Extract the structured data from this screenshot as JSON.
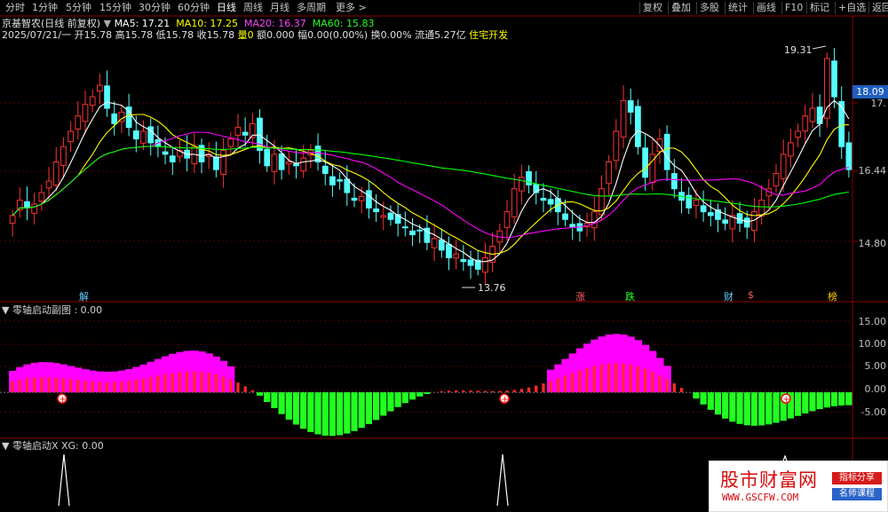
{
  "toolbar": {
    "periods": [
      "分时",
      "1分钟",
      "5分钟",
      "15分钟",
      "30分钟",
      "60分钟",
      "日线",
      "周线",
      "月线",
      "多周期",
      "更多"
    ],
    "active_period": "日线",
    "right_buttons": [
      "复权",
      "叠加",
      "多股",
      "统计",
      "画线",
      "F10",
      "标记",
      "+自选",
      "返回"
    ]
  },
  "stock": {
    "name": "京基智农(日线 前复权)",
    "ma_legend": {
      "ma5": {
        "label": "MA5:",
        "value": "17.21",
        "color": "#ffffff"
      },
      "ma10": {
        "label": "MA10:",
        "value": "17.25",
        "color": "#ffff00"
      },
      "ma20": {
        "label": "MA20:",
        "value": "16.37",
        "color": "#ff00ff"
      },
      "ma60": {
        "label": "MA60:",
        "value": "15.83",
        "color": "#00ff00"
      }
    },
    "date": "2025/07/21/一",
    "open_label": "开",
    "open": "15.78",
    "high_label": "高",
    "high": "15.78",
    "low_label": "低",
    "low": "15.78",
    "close_label": "收",
    "close": "15.78",
    "vol_label": "量",
    "vol": "0",
    "amount_label": "额",
    "amount": "0.000",
    "change_label": "幅",
    "change": "0.00(0.00%)",
    "turnover_label": "换",
    "turnover": "0.00%",
    "float_label": "流通",
    "float": "5.27亿",
    "sector": "住宅开发"
  },
  "price_axis": {
    "labels": [
      "18.09",
      "17.",
      "16.44",
      "14.80"
    ],
    "current_price": "18.09",
    "high_mark": "19.31",
    "low_mark": "13.76"
  },
  "events": [
    {
      "text": "解",
      "color": "#66ccff"
    },
    {
      "text": "涨",
      "color": "#ff6060"
    },
    {
      "text": "跌",
      "color": "#22ff22"
    },
    {
      "text": "财",
      "color": "#66ccff"
    },
    {
      "text": "$",
      "color": "#ff6060"
    },
    {
      "text": "榜",
      "color": "#ffcc00"
    }
  ],
  "sub1": {
    "label": "零轴启动副图 : 0.00",
    "axis": [
      "15.00",
      "10.00",
      "5.00",
      "0.00",
      "-5.00"
    ]
  },
  "sub2": {
    "label": "零轴启动X XG: 0.00"
  },
  "watermark": {
    "title": "股市财富网",
    "url": "WWW.GSCFW.COM",
    "badge1": "指标分享",
    "badge2": "名师课程",
    "badge1_color": "#d81b1b",
    "badge2_color": "#2a63c9"
  },
  "chart_data": {
    "type": "candlestick",
    "closes": [
      15.2,
      15.6,
      15.4,
      15.5,
      15.8,
      16.1,
      16.6,
      17.0,
      17.4,
      17.8,
      18.1,
      18.3,
      18.6,
      18.0,
      17.6,
      17.9,
      17.5,
      17.2,
      17.4,
      17.1,
      17.0,
      16.8,
      16.6,
      16.9,
      16.7,
      17.0,
      16.6,
      16.8,
      16.4,
      16.9,
      17.2,
      17.5,
      17.3,
      17.6,
      16.9,
      16.5,
      16.8,
      16.4,
      16.6,
      16.5,
      16.7,
      16.9,
      16.6,
      16.3,
      16.0,
      16.1,
      15.8,
      15.6,
      15.7,
      15.4,
      15.3,
      15.2,
      15.1,
      15.0,
      14.9,
      14.7,
      14.8,
      14.5,
      14.6,
      14.3,
      14.1,
      14.2,
      14.0,
      13.9,
      13.8,
      14.1,
      14.4,
      14.8,
      15.3,
      15.9,
      16.2,
      16.0,
      15.8,
      15.6,
      15.5,
      15.3,
      15.1,
      14.9,
      14.8,
      15.0,
      15.3,
      15.9,
      16.6,
      17.4,
      18.2,
      17.9,
      17.0,
      16.2,
      16.8,
      17.2,
      16.4,
      15.9,
      15.6,
      15.4,
      15.6,
      15.3,
      15.2,
      15.1,
      15.0,
      15.2,
      15.0,
      14.9,
      15.3,
      15.6,
      15.9,
      16.3,
      16.8,
      17.1,
      17.4,
      17.8,
      18.0,
      17.6,
      19.3,
      18.3,
      17.0,
      16.4
    ],
    "ma_colors": [
      "#ffffff",
      "#ffff00",
      "#ff00ff",
      "#00ff00"
    ],
    "sub1_axis_range": [
      -9,
      16
    ],
    "xg_signal_positions": [
      15,
      117
    ]
  }
}
